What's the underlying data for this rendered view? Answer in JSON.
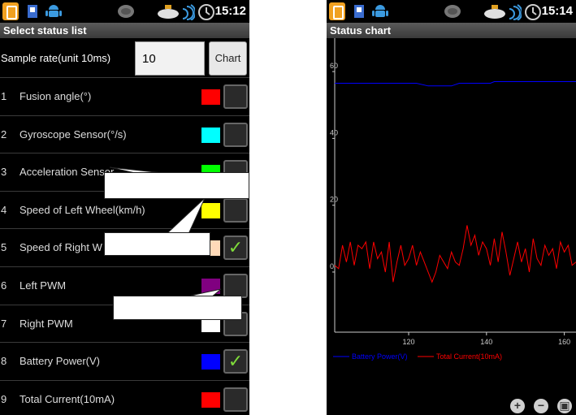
{
  "left_screen": {
    "status_bar": {
      "time": "15:12"
    },
    "title": "Select status list",
    "sample_rate": {
      "label": "Sample rate(unit 10ms)",
      "value": "10"
    },
    "chart_button_label": "Chart",
    "status_items": [
      {
        "index": "1",
        "name": "Fusion angle(°)",
        "color": "#ff0000",
        "checked": false
      },
      {
        "index": "2",
        "name": "Gyroscope Sensor(°/s)",
        "color": "#00ffff",
        "checked": false
      },
      {
        "index": "3",
        "name": "Acceleration Sensor",
        "color": "#00ff00",
        "checked": false
      },
      {
        "index": "4",
        "name": "Speed of Left Wheel(km/h)",
        "color": "#ffff00",
        "checked": false
      },
      {
        "index": "5",
        "name": "Speed of Right W",
        "color": "#ffdab9",
        "checked": true
      },
      {
        "index": "6",
        "name": "Left PWM",
        "color": "#800080",
        "checked": false
      },
      {
        "index": "7",
        "name": "Right PWM",
        "color": "#ffffff",
        "checked": false
      },
      {
        "index": "8",
        "name": "Battery Power(V)",
        "color": "#0000ff",
        "checked": true
      },
      {
        "index": "9",
        "name": "Total Current(10mA)",
        "color": "#ff0000",
        "checked": false
      }
    ]
  },
  "right_screen": {
    "status_bar": {
      "time": "15:14"
    },
    "title": "Status chart"
  },
  "chart_data": {
    "type": "line",
    "title": "",
    "xlabel": "",
    "ylabel": "",
    "xlim": [
      101,
      163
    ],
    "ylim": [
      -18,
      70
    ],
    "x_ticks": [
      120,
      140,
      160
    ],
    "y_ticks": [
      0,
      20,
      40,
      60
    ],
    "grid": false,
    "legend_position": "bottom",
    "series": [
      {
        "name": "Battery Power(V)",
        "color": "#0000ff",
        "x": [
          101,
          122,
          125,
          131,
          133,
          141,
          142,
          163
        ],
        "y": [
          56.5,
          56.5,
          55.7,
          55.7,
          56.5,
          56.5,
          57.0,
          57.0
        ]
      },
      {
        "name": "Total Current(10mA)",
        "color": "#ff0000",
        "x": [
          101,
          102,
          103,
          104,
          105,
          106,
          107,
          108,
          109,
          110,
          111,
          112,
          113,
          114,
          115,
          116,
          117,
          118,
          119,
          120,
          121,
          122,
          123,
          124,
          125,
          126,
          127,
          128,
          129,
          130,
          131,
          132,
          133,
          134,
          135,
          136,
          137,
          138,
          139,
          140,
          141,
          142,
          143,
          144,
          145,
          146,
          147,
          148,
          149,
          150,
          151,
          152,
          153,
          154,
          155,
          156,
          157,
          158,
          159,
          160,
          161,
          162,
          163
        ],
        "y": [
          2,
          1,
          8,
          3,
          9,
          2,
          8,
          7,
          9,
          1,
          9,
          4,
          6,
          0,
          9,
          -3,
          3,
          8,
          2,
          4,
          8,
          2,
          6,
          3,
          0,
          -3,
          0,
          5,
          3,
          1,
          6,
          3,
          2,
          7,
          14,
          8,
          11,
          5,
          9,
          7,
          2,
          10,
          3,
          12,
          6,
          -1,
          4,
          9,
          3,
          7,
          0,
          10,
          4,
          2,
          8,
          5,
          7,
          1,
          9,
          6,
          8,
          2,
          3
        ]
      }
    ]
  },
  "icons": {
    "status_bar": [
      "app-icon",
      "usb-icon",
      "android-icon",
      "satellite-icon",
      "wifi-icon",
      "signal-icon",
      "clock-icon"
    ],
    "zoom": [
      "zoom-in-icon",
      "zoom-out-icon",
      "zoom-reset-icon"
    ]
  }
}
